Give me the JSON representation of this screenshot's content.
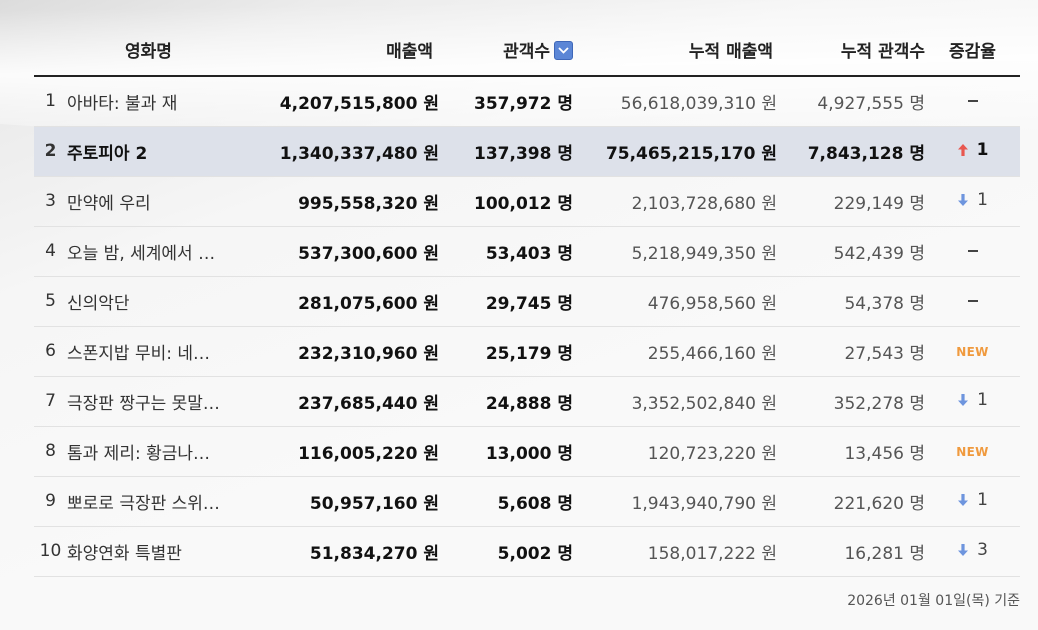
{
  "colors": {
    "highlight_row": "#dde1ea",
    "sort_button": "#5b86d6",
    "up_arrow": "#e8574f",
    "down_arrow": "#6e95de",
    "new_badge": "#f09a3e"
  },
  "header": {
    "title": "영화명",
    "sales": "매출액",
    "audience": "관객수",
    "cum_sales": "누적 매출액",
    "cum_audience": "누적 관객수",
    "change": "증감율",
    "sort_icon": "chevron-down-icon"
  },
  "rows": [
    {
      "rank": "1",
      "title": "아바타: 불과 재",
      "sales": "4,207,515,800 원",
      "audience": "357,972 명",
      "cum_sales": "56,618,039,310 원",
      "cum_audience": "4,927,555 명",
      "change": {
        "type": "none",
        "value": ""
      },
      "highlight": false
    },
    {
      "rank": "2",
      "title": "주토피아 2",
      "sales": "1,340,337,480 원",
      "audience": "137,398 명",
      "cum_sales": "75,465,215,170 원",
      "cum_audience": "7,843,128 명",
      "change": {
        "type": "up",
        "value": "1"
      },
      "highlight": true
    },
    {
      "rank": "3",
      "title": "만약에 우리",
      "sales": "995,558,320 원",
      "audience": "100,012 명",
      "cum_sales": "2,103,728,680 원",
      "cum_audience": "229,149 명",
      "change": {
        "type": "down",
        "value": "1"
      },
      "highlight": false
    },
    {
      "rank": "4",
      "title": "오늘 밤, 세계에서 …",
      "sales": "537,300,600 원",
      "audience": "53,403 명",
      "cum_sales": "5,218,949,350 원",
      "cum_audience": "542,439 명",
      "change": {
        "type": "none",
        "value": ""
      },
      "highlight": false
    },
    {
      "rank": "5",
      "title": "신의악단",
      "sales": "281,075,600 원",
      "audience": "29,745 명",
      "cum_sales": "476,958,560 원",
      "cum_audience": "54,378 명",
      "change": {
        "type": "none",
        "value": ""
      },
      "highlight": false
    },
    {
      "rank": "6",
      "title": "스폰지밥 무비: 네…",
      "sales": "232,310,960 원",
      "audience": "25,179 명",
      "cum_sales": "255,466,160 원",
      "cum_audience": "27,543 명",
      "change": {
        "type": "new",
        "value": "NEW"
      },
      "highlight": false
    },
    {
      "rank": "7",
      "title": "극장판 짱구는 못말…",
      "sales": "237,685,440 원",
      "audience": "24,888 명",
      "cum_sales": "3,352,502,840 원",
      "cum_audience": "352,278 명",
      "change": {
        "type": "down",
        "value": "1"
      },
      "highlight": false
    },
    {
      "rank": "8",
      "title": "톰과 제리: 황금나…",
      "sales": "116,005,220 원",
      "audience": "13,000 명",
      "cum_sales": "120,723,220 원",
      "cum_audience": "13,456 명",
      "change": {
        "type": "new",
        "value": "NEW"
      },
      "highlight": false
    },
    {
      "rank": "9",
      "title": "뽀로로 극장판 스위…",
      "sales": "50,957,160 원",
      "audience": "5,608 명",
      "cum_sales": "1,943,940,790 원",
      "cum_audience": "221,620 명",
      "change": {
        "type": "down",
        "value": "1"
      },
      "highlight": false
    },
    {
      "rank": "10",
      "title": "화양연화 특별판",
      "sales": "51,834,270 원",
      "audience": "5,002 명",
      "cum_sales": "158,017,222 원",
      "cum_audience": "16,281 명",
      "change": {
        "type": "down",
        "value": "3"
      },
      "highlight": false
    }
  ],
  "footnote": "2026년 01월 01일(목) 기준"
}
